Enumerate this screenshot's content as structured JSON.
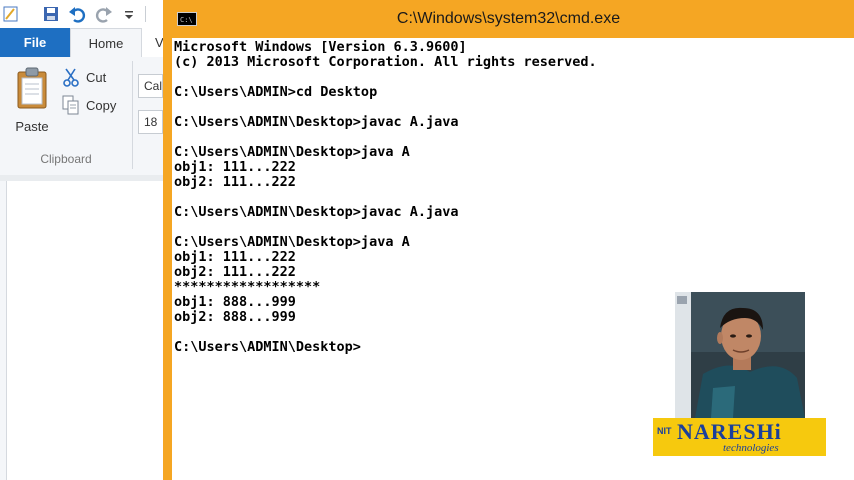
{
  "wordpad": {
    "tabs": {
      "file": "File",
      "home": "Home",
      "view": "V"
    },
    "clipboard": {
      "paste": "Paste",
      "cut": "Cut",
      "copy": "Copy",
      "group_label": "Clipboard"
    },
    "font_family_partial": "Cal",
    "font_size_partial": "18"
  },
  "cmd": {
    "title": "C:\\Windows\\system32\\cmd.exe",
    "lines": [
      "Microsoft Windows [Version 6.3.9600]",
      "(c) 2013 Microsoft Corporation. All rights reserved.",
      "",
      "C:\\Users\\ADMIN>cd Desktop",
      "",
      "C:\\Users\\ADMIN\\Desktop>javac A.java",
      "",
      "C:\\Users\\ADMIN\\Desktop>java A",
      "obj1: 111...222",
      "obj2: 111...222",
      "",
      "C:\\Users\\ADMIN\\Desktop>javac A.java",
      "",
      "C:\\Users\\ADMIN\\Desktop>java A",
      "obj1: 111...222",
      "obj2: 111...222",
      "******************",
      "obj1: 888...999",
      "obj2: 888...999",
      "",
      "C:\\Users\\ADMIN\\Desktop>"
    ]
  },
  "overlay": {
    "logo_prefix": "NIT",
    "logo_name": "NARESHi",
    "logo_sub": "technologies"
  },
  "colors": {
    "cmd_frame": "#f5a623",
    "file_tab": "#1e6fc2",
    "logo_bg": "#f6c90e",
    "logo_text": "#1b3f9a"
  }
}
